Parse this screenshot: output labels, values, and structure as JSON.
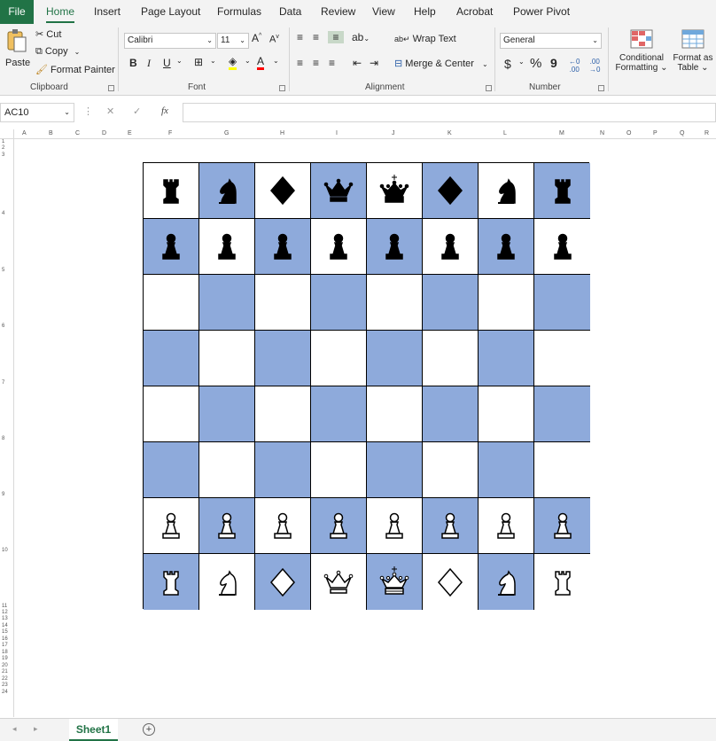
{
  "ribbon_tabs": [
    "File",
    "Home",
    "Insert",
    "Page Layout",
    "Formulas",
    "Data",
    "Review",
    "View",
    "Help",
    "Acrobat",
    "Power Pivot"
  ],
  "clipboard": {
    "paste": "Paste",
    "cut": "Cut",
    "copy": "Copy",
    "format_painter": "Format Painter",
    "label": "Clipboard"
  },
  "font": {
    "family": "Calibri",
    "size": "11",
    "bold": "B",
    "italic": "I",
    "underline": "U",
    "label": "Font"
  },
  "alignment": {
    "wrap_text": "Wrap Text",
    "merge_center": "Merge & Center",
    "label": "Alignment"
  },
  "number": {
    "format": "General",
    "currency": "$",
    "percent": "%",
    "comma": "9",
    "label": "Number"
  },
  "styles": {
    "conditional_formatting_1": "Conditional",
    "conditional_formatting_2": "Formatting",
    "format_as_table_1": "Format as",
    "format_as_table_2": "Table"
  },
  "formula_bar": {
    "name_box": "AC10",
    "cancel": "✕",
    "enter": "✓",
    "fx": "fx",
    "value": ""
  },
  "columns": [
    "A",
    "B",
    "C",
    "D",
    "E",
    "F",
    "G",
    "H",
    "I",
    "J",
    "K",
    "L",
    "M",
    "N",
    "O",
    "P",
    "Q",
    "R"
  ],
  "rows": [
    "1",
    "2",
    "3",
    "4",
    "5",
    "6",
    "7",
    "8",
    "9",
    "10",
    "11",
    "12",
    "13",
    "14",
    "15",
    "16",
    "17",
    "18",
    "19",
    "20",
    "21",
    "22",
    "23",
    "24"
  ],
  "sheet_tab": "Sheet1",
  "colors": {
    "light": "#ffffff",
    "dark": "#8eaadb",
    "accent": "#217346"
  },
  "board": {
    "ranks": [
      [
        "black-rook",
        "black-knight",
        "black-bishop-diamond",
        "black-queen-crown",
        "black-king-crown",
        "black-bishop-diamond",
        "black-knight",
        "black-rook"
      ],
      [
        "black-pawn",
        "black-pawn",
        "black-pawn",
        "black-pawn",
        "black-pawn",
        "black-pawn",
        "black-pawn",
        "black-pawn"
      ],
      [
        "",
        "",
        "",
        "",
        "",
        "",
        "",
        ""
      ],
      [
        "",
        "",
        "",
        "",
        "",
        "",
        "",
        ""
      ],
      [
        "",
        "",
        "",
        "",
        "",
        "",
        "",
        ""
      ],
      [
        "",
        "",
        "",
        "",
        "",
        "",
        "",
        ""
      ],
      [
        "white-pawn",
        "white-pawn",
        "white-pawn",
        "white-pawn",
        "white-pawn",
        "white-pawn",
        "white-pawn",
        "white-pawn"
      ],
      [
        "white-rook",
        "white-knight",
        "white-bishop-diamond",
        "white-queen-crown",
        "white-king-crown",
        "white-bishop-diamond",
        "white-knight",
        "white-rook"
      ]
    ]
  }
}
